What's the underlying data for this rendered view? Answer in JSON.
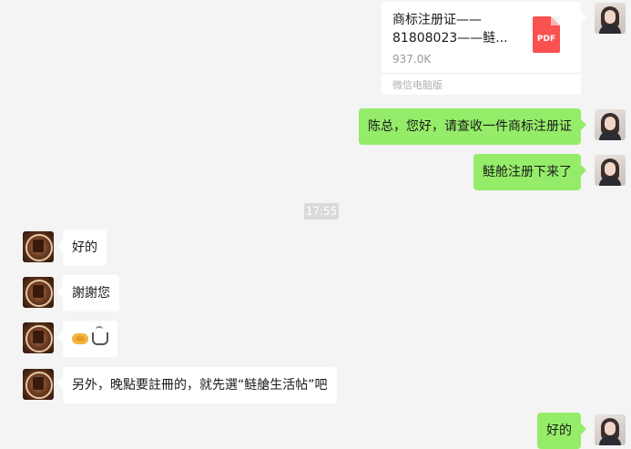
{
  "messages": {
    "file": {
      "name_line1": "商标注册证——",
      "name_line2": "81808023——鲢...",
      "icon_label": "PDF",
      "size": "937.0K",
      "source": "微信电脑版"
    },
    "me_1": "陈总，您好，请查收一件商标注册证",
    "me_2": "鲢舱注册下来了",
    "timestamp": "17:55",
    "other_1": "好的",
    "other_2": "謝謝您",
    "other_4": "另外，晚點要註冊的，就先選“鲢艙生活帖”吧",
    "me_3": "好的"
  },
  "icons": {
    "my_avatar": "user-avatar-photo",
    "other_avatar": "contact-avatar-logo",
    "file_icon": "pdf-file-icon",
    "emoji_1": "handshake-emoji",
    "emoji_2": "hot-beverage-emoji"
  },
  "colors": {
    "outgoing_bubble": "#95ec69",
    "incoming_bubble": "#ffffff",
    "background": "#f4f4f4",
    "pdf_red": "#fa5151"
  }
}
